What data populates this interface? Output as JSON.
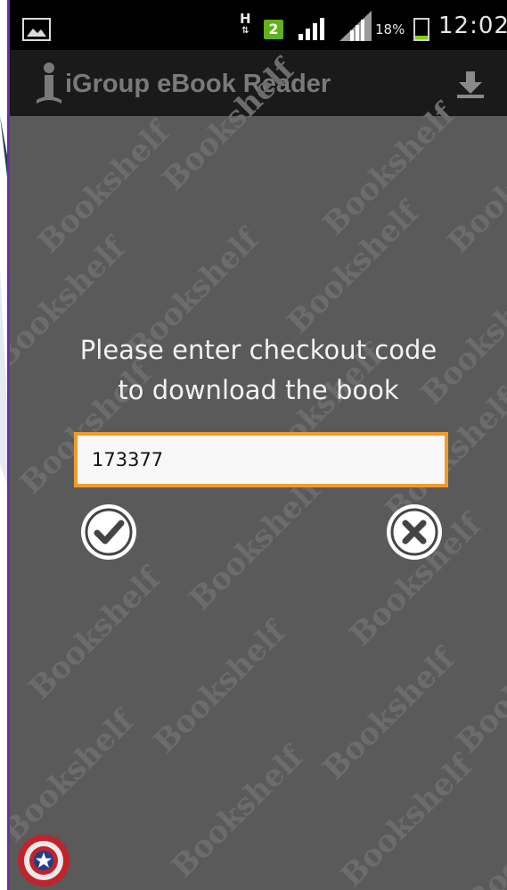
{
  "statusbar": {
    "network_type": "H",
    "sim_number": "2",
    "battery_percent": "18%",
    "time": "12:02",
    "battery_level": 0.18
  },
  "titlebar": {
    "app_title": "iGroup eBook Reader",
    "download_icon": "download-icon",
    "logo_icon": "reader-logo-icon"
  },
  "main": {
    "prompt_line1": "Please enter checkout code",
    "prompt_line2": "to download the book",
    "code_value": "173377",
    "confirm_icon": "check-circle-icon",
    "cancel_icon": "close-circle-icon",
    "watermark_text": "Bookshelf"
  },
  "colors": {
    "background": "#5a5a5a",
    "titlebar": "#1a1a1a",
    "input_border": "#f19b2c",
    "sim_badge": "#5fb219",
    "frame_accent": "#6b2fa3"
  }
}
